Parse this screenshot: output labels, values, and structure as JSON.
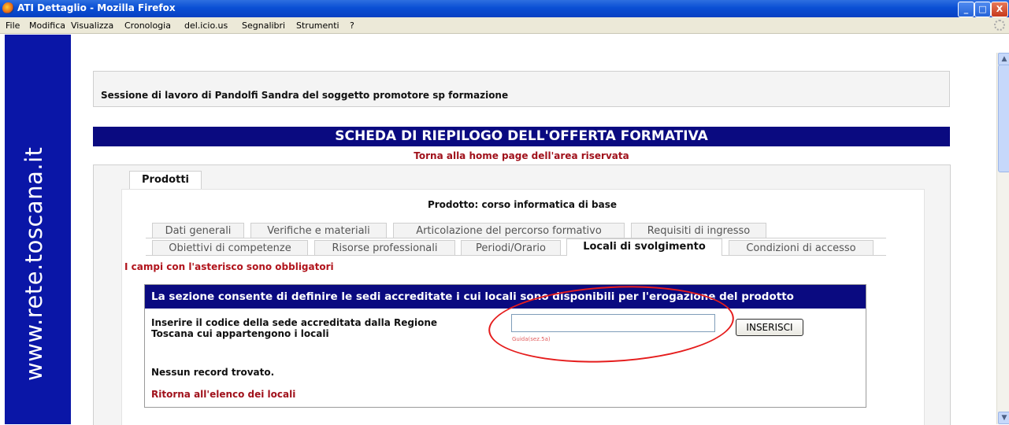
{
  "window": {
    "title": "ATI Dettaglio - Mozilla Firefox",
    "buttons": {
      "minimize": "_",
      "maximize": "□",
      "close": "X"
    }
  },
  "menubar": {
    "items": [
      "File",
      "Modifica",
      "Visualizza",
      "Cronologia",
      "del.icio.us",
      "Segnalibri",
      "Strumenti",
      "?"
    ]
  },
  "sidebar": {
    "banner_text": "www.rete.toscana.it"
  },
  "session": {
    "text": "Sessione di lavoro di Pandolfi Sandra del soggetto promotore sp formazione"
  },
  "header": {
    "title": "SCHEDA DI RIEPILOGO DELL'OFFERTA FORMATIVA",
    "home_link": "Torna alla home page dell'area riservata"
  },
  "main_tab": {
    "label": "Prodotti"
  },
  "product": {
    "title": "Prodotto: corso informatica di base"
  },
  "tabs_row1": [
    {
      "label": "Dati generali"
    },
    {
      "label": "Verifiche e materiali"
    },
    {
      "label": "Articolazione del percorso formativo"
    },
    {
      "label": "Requisiti di ingresso"
    }
  ],
  "tabs_row2": [
    {
      "label": "Obiettivi di competenze"
    },
    {
      "label": "Risorse professionali"
    },
    {
      "label": "Periodi/Orario"
    },
    {
      "label": "Locali di svolgimento",
      "active": true
    },
    {
      "label": "Condizioni di accesso"
    }
  ],
  "required_note": "I campi con l'asterisco sono obbligatori",
  "section": {
    "heading": "La sezione consente di definire le sedi accreditate i cui locali sono disponibili per l'erogazione del prodotto",
    "field_label": "Inserire il codice della sede accreditata dalla Regione Toscana cui appartengono i locali",
    "input_value": "",
    "guida": "Guida(sez.5a)",
    "insert_button": "INSERISCI",
    "no_record": "Nessun record trovato.",
    "back_link": "Ritorna all'elenco dei locali"
  },
  "colors": {
    "banner_blue": "#0a16a7",
    "header_navy": "#0a0a80",
    "link_red": "#a0111b",
    "annotation_red": "#e51c1c"
  }
}
